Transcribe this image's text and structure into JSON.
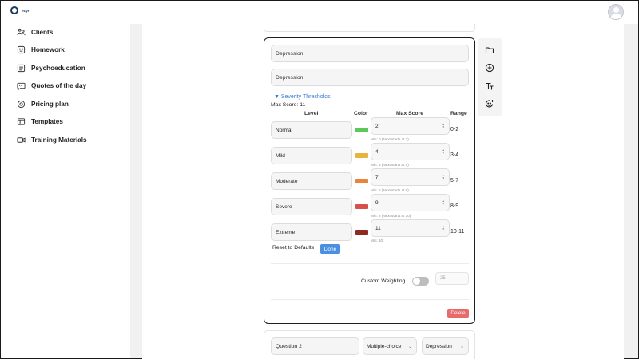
{
  "app": {
    "logo_text": "eslyr"
  },
  "sidebar": {
    "items": [
      {
        "label": "Clients",
        "icon": "users-icon"
      },
      {
        "label": "Homework",
        "icon": "homework-icon"
      },
      {
        "label": "Psychoeducation",
        "icon": "book-icon"
      },
      {
        "label": "Quotes of the day",
        "icon": "quote-icon"
      },
      {
        "label": "Pricing plan",
        "icon": "target-icon"
      },
      {
        "label": "Templates",
        "icon": "template-icon"
      },
      {
        "label": "Training Materials",
        "icon": "video-icon"
      }
    ]
  },
  "question": {
    "title_value": "Depression",
    "category_value": "Depression",
    "severity_toggle_label": "▼ Severity Thresholds",
    "max_score_label": "Max Score: 11",
    "headers": {
      "level": "Level",
      "color": "Color",
      "max_score": "Max Score",
      "range": "Range"
    },
    "thresholds": [
      {
        "level": "Normal",
        "color": "#5cc85c",
        "max": "2",
        "hint": "Min: 0 (Next starts at 3)",
        "range": "0-2"
      },
      {
        "level": "Mild",
        "color": "#e9b43c",
        "max": "4",
        "hint": "Min: 3 (Next starts at 5)",
        "range": "3-4"
      },
      {
        "level": "Moderate",
        "color": "#e8853a",
        "max": "7",
        "hint": "Min: 5 (Next starts at 8)",
        "range": "5-7"
      },
      {
        "level": "Severe",
        "color": "#d9504a",
        "max": "9",
        "hint": "Min: 8 (Next starts at 10)",
        "range": "8-9"
      },
      {
        "level": "Extreme",
        "color": "#8e2a22",
        "max": "11",
        "hint": "Min: 10",
        "range": "10-11"
      }
    ],
    "reset_label": "Reset to Defaults",
    "done_label": "Done",
    "custom_weighting_label": "Custom Weighting",
    "custom_weighting_enabled": false,
    "weight_placeholder": "25",
    "delete_label": "Delete"
  },
  "toolbar": {
    "tools": [
      "folder-icon",
      "add-circle-icon",
      "text-format-icon",
      "add-emoji-icon"
    ]
  },
  "next_question": {
    "title_value": "Question 2",
    "type_value": "Multiple-choice",
    "category_value": "Depression"
  }
}
